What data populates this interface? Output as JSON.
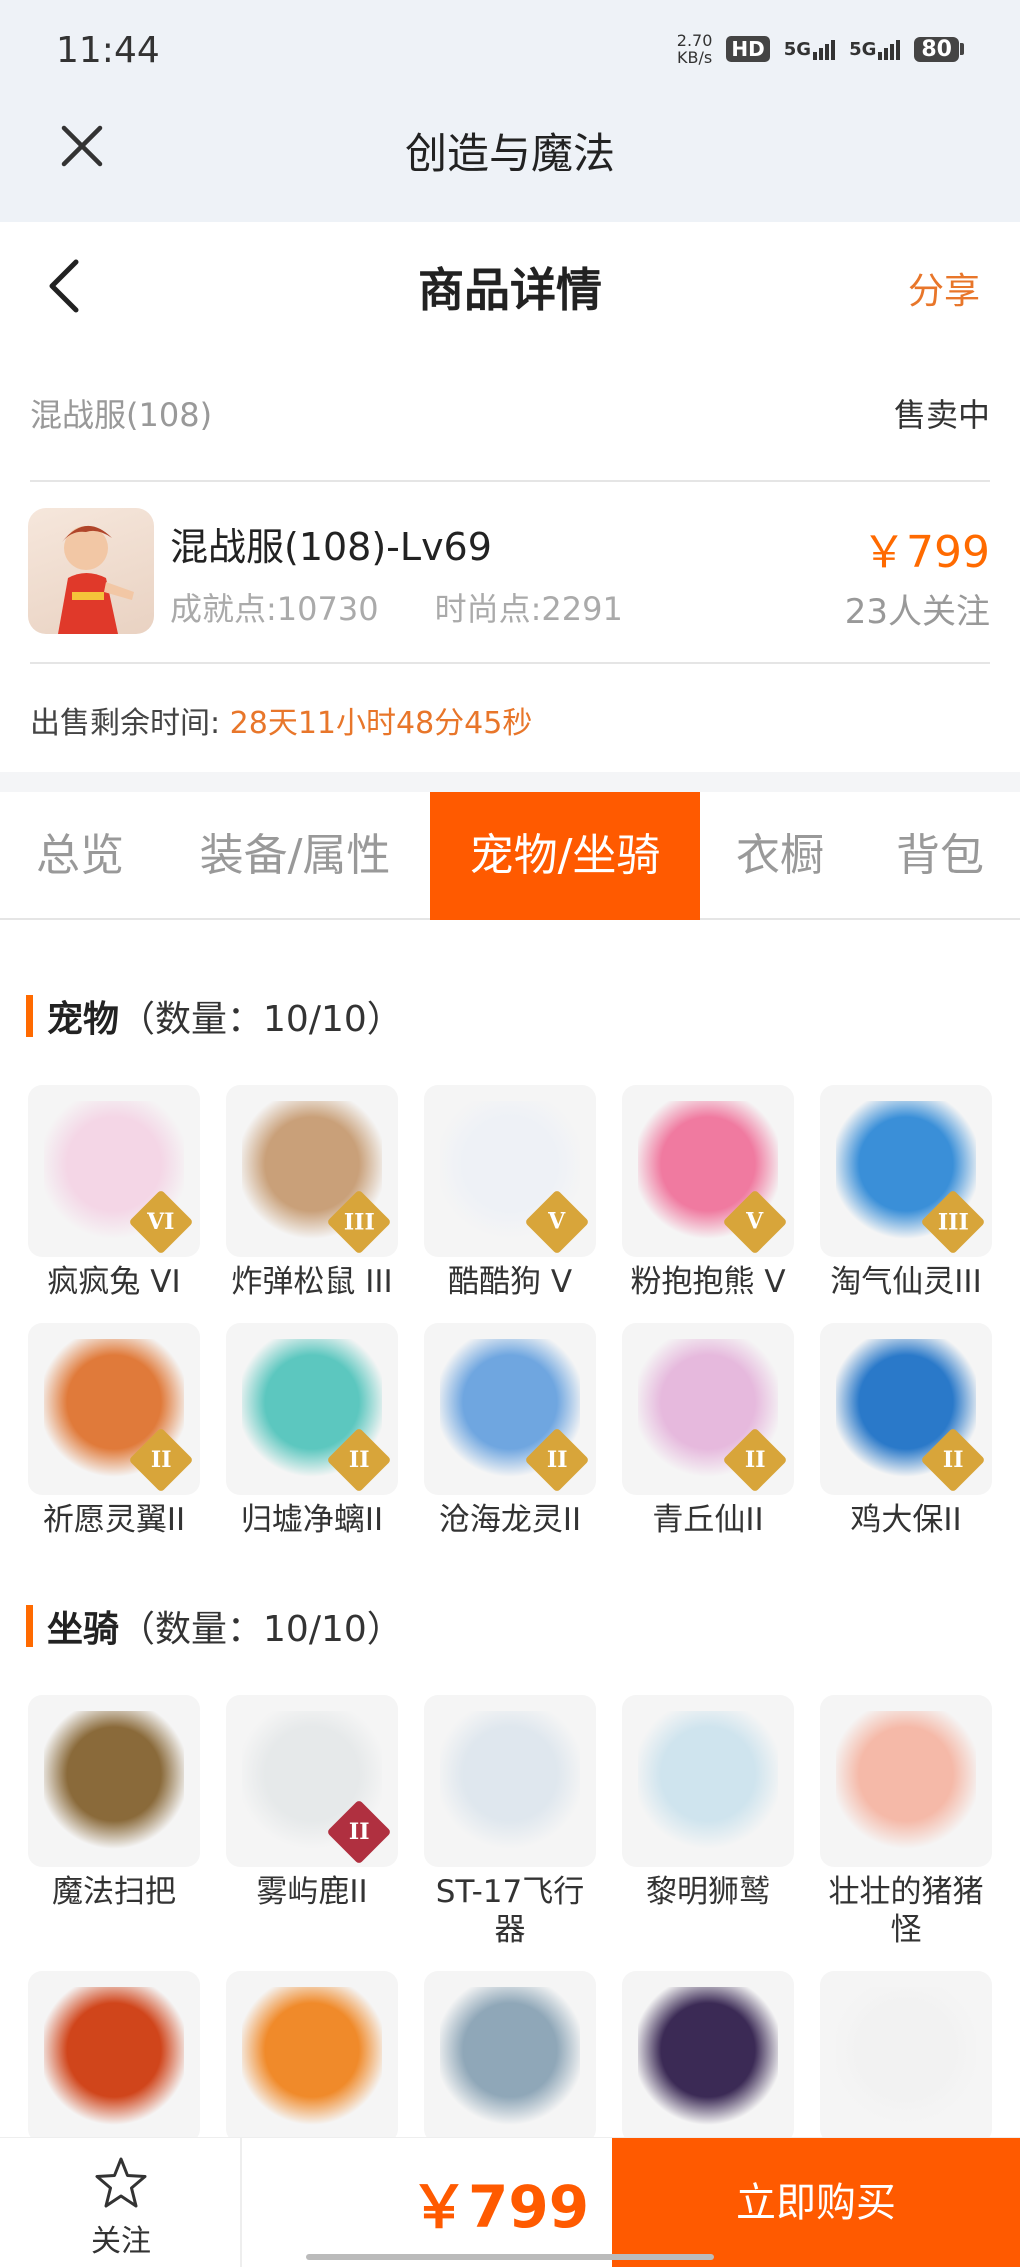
{
  "status_bar": {
    "time": "11:44",
    "net_speed_value": "2.70",
    "net_speed_unit": "KB/s",
    "hd": "HD",
    "sim1": "5G",
    "sim2": "5G",
    "battery": "80"
  },
  "app": {
    "title": "创造与魔法"
  },
  "header": {
    "title": "商品详情",
    "share": "分享"
  },
  "listing": {
    "server": "混战服(108)",
    "status": "售卖中",
    "name": "混战服(108)-Lv69",
    "achievement": "成就点:10730",
    "fashion": "时尚点:2291",
    "price": "￥799",
    "watchers": "23人关注",
    "remaining_label": "出售剩余时间:",
    "remaining_value": "28天11小时48分45秒"
  },
  "tabs": [
    {
      "label": "总览"
    },
    {
      "label": "装备/属性"
    },
    {
      "label": "宠物/坐骑",
      "active": true
    },
    {
      "label": "衣橱"
    },
    {
      "label": "背包"
    }
  ],
  "pets": {
    "title": "宠物",
    "count": "（数量：10/10）",
    "items": [
      {
        "name": "疯疯兔 VI",
        "badge": "VI",
        "icon": "rabbit-pet-icon",
        "color": "#f4d6e6"
      },
      {
        "name": "炸弹松鼠 III",
        "badge": "III",
        "icon": "squirrel-pet-icon",
        "color": "#c9a079"
      },
      {
        "name": "酷酷狗 V",
        "badge": "V",
        "icon": "white-dog-pet-icon",
        "color": "#eef1f6"
      },
      {
        "name": "粉抱抱熊 V",
        "badge": "V",
        "icon": "pink-bear-pet-icon",
        "color": "#f07aa0"
      },
      {
        "name": "淘气仙灵III",
        "badge": "III",
        "icon": "blue-fairy-pet-icon",
        "color": "#3a8fd8"
      },
      {
        "name": "祈愿灵翼II",
        "badge": "II",
        "icon": "eagle-pet-icon",
        "color": "#e07a3a"
      },
      {
        "name": "归墟净螭II",
        "badge": "II",
        "icon": "teal-dragon-pet-icon",
        "color": "#5cc7bf"
      },
      {
        "name": "沧海龙灵II",
        "badge": "II",
        "icon": "dragon-boy-pet-icon",
        "color": "#6fa6e0"
      },
      {
        "name": "青丘仙II",
        "badge": "II",
        "icon": "fox-fairy-pet-icon",
        "color": "#e6b9dd"
      },
      {
        "name": "鸡大保II",
        "badge": "II",
        "icon": "blue-chicken-pet-icon",
        "color": "#2a79c9"
      }
    ]
  },
  "mounts": {
    "title": "坐骑",
    "count": "（数量：10/10）",
    "items": [
      {
        "name": "魔法扫把",
        "icon": "broom-mount-icon",
        "color": "#8a6a3a"
      },
      {
        "name": "雾屿鹿II",
        "badge": "II",
        "icon": "deer-mount-icon",
        "color": "#e6e9ea"
      },
      {
        "name": "ST-17飞行器",
        "icon": "aircraft-mount-icon",
        "color": "#dfe7ee"
      },
      {
        "name": "黎明狮鹫",
        "icon": "griffin-mount-icon",
        "color": "#cfe4ee"
      },
      {
        "name": "壮壮的猪猪怪",
        "icon": "pig-mount-icon",
        "color": "#f5b9a8"
      },
      {
        "name": "",
        "icon": "fire-dragon-mount-icon",
        "color": "#d0451b"
      },
      {
        "name": "",
        "icon": "phoenix-mount-icon",
        "color": "#f08a2a"
      },
      {
        "name": "",
        "icon": "shark-mount-icon",
        "color": "#8fa7b8"
      },
      {
        "name": "",
        "icon": "dark-dragon-mount-icon",
        "color": "#3b2a55"
      },
      {
        "name": "",
        "icon": "white-cat-mount-icon",
        "color": "#f2f2f2"
      }
    ]
  },
  "bottom": {
    "favorite": "关注",
    "price": "￥799",
    "buy": "立即购买"
  },
  "colors": {
    "accent": "#ff5a00",
    "price": "#ff6a00",
    "highlight": "#e8762a"
  }
}
